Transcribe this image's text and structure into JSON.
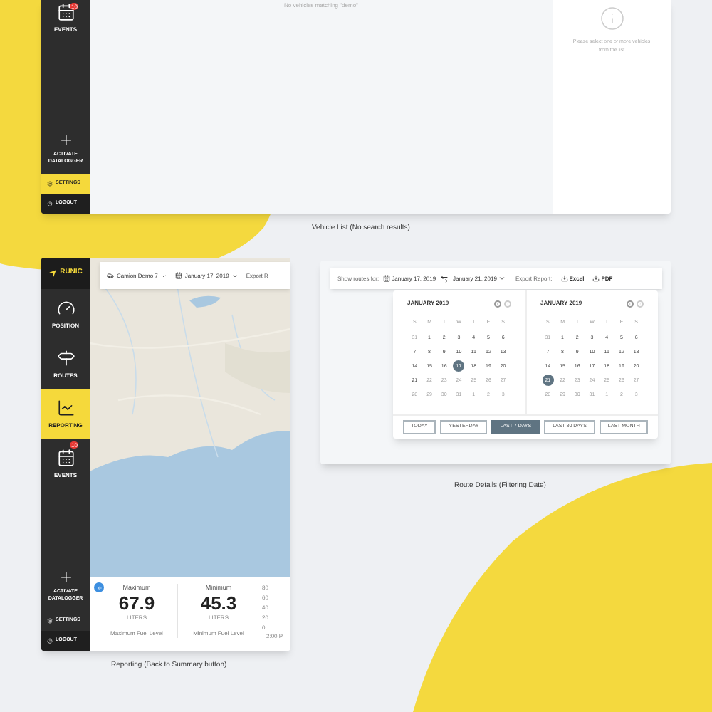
{
  "vehicle_list": {
    "sidebar": {
      "items": [
        {
          "kind": "events",
          "label": "EVENTS",
          "badge": "10",
          "selected": false
        }
      ],
      "activate": "ACTIVATE DATALOGGER",
      "settings": {
        "label": "SETTINGS",
        "selected": true
      },
      "logout": "LOGOUT"
    },
    "empty_message": "No vehicles matching \"demo\"",
    "detail_hint": "Please select one or more vehicles from the list",
    "caption": "Vehicle List (No search results)"
  },
  "reporting": {
    "logo": "RUNIC",
    "sidebar": {
      "items": [
        {
          "kind": "position",
          "label": "POSITION",
          "selected": false
        },
        {
          "kind": "routes",
          "label": "ROUTES",
          "selected": false
        },
        {
          "kind": "reporting",
          "label": "REPORTING",
          "selected": true
        },
        {
          "kind": "events",
          "label": "EVENTS",
          "badge": "10",
          "selected": false
        }
      ],
      "activate": "ACTIVATE DATALOGGER",
      "settings": {
        "label": "SETTINGS",
        "selected": false
      },
      "logout": "LOGOUT"
    },
    "toolbar": {
      "vehicle": "Camion Demo 7",
      "date": "January 17, 2019",
      "export": "Export R"
    },
    "stats": [
      {
        "title": "Maximum",
        "value": "67.9",
        "unit": "LITERS",
        "caption": "Maximum Fuel Level"
      },
      {
        "title": "Minimum",
        "value": "45.3",
        "unit": "LITERS",
        "caption": "Minimum Fuel Level"
      }
    ],
    "chart_ticks": [
      "80",
      "60",
      "40",
      "20",
      "0"
    ],
    "chart_time": "2:00 P",
    "caption": "Reporting (Back to Summary button)"
  },
  "route_details": {
    "toolbar": {
      "label": "Show routes for:",
      "from": "January 17, 2019",
      "to": "January 21, 2019",
      "export_label": "Export Report:",
      "exports": [
        "Excel",
        "PDF"
      ]
    },
    "calendars": [
      {
        "month": "JANUARY 2019",
        "weekdays": [
          "S",
          "M",
          "T",
          "W",
          "T",
          "F",
          "S"
        ],
        "days": [
          {
            "label": "31",
            "muted": true,
            "selected": false
          },
          {
            "label": "1",
            "muted": false,
            "selected": false
          },
          {
            "label": "2",
            "muted": false,
            "selected": false
          },
          {
            "label": "3",
            "muted": false,
            "selected": false
          },
          {
            "label": "4",
            "muted": false,
            "selected": false
          },
          {
            "label": "5",
            "muted": false,
            "selected": false
          },
          {
            "label": "6",
            "muted": false,
            "selected": false
          },
          {
            "label": "7",
            "muted": false,
            "selected": false
          },
          {
            "label": "8",
            "muted": false,
            "selected": false
          },
          {
            "label": "9",
            "muted": false,
            "selected": false
          },
          {
            "label": "10",
            "muted": false,
            "selected": false
          },
          {
            "label": "11",
            "muted": false,
            "selected": false
          },
          {
            "label": "12",
            "muted": false,
            "selected": false
          },
          {
            "label": "13",
            "muted": false,
            "selected": false
          },
          {
            "label": "14",
            "muted": false,
            "selected": false
          },
          {
            "label": "15",
            "muted": false,
            "selected": false
          },
          {
            "label": "16",
            "muted": false,
            "selected": false
          },
          {
            "label": "17",
            "muted": false,
            "selected": true
          },
          {
            "label": "18",
            "muted": false,
            "selected": false
          },
          {
            "label": "19",
            "muted": false,
            "selected": false
          },
          {
            "label": "20",
            "muted": false,
            "selected": false
          },
          {
            "label": "21",
            "muted": false,
            "selected": false
          },
          {
            "label": "22",
            "muted": true,
            "selected": false
          },
          {
            "label": "23",
            "muted": true,
            "selected": false
          },
          {
            "label": "24",
            "muted": true,
            "selected": false
          },
          {
            "label": "25",
            "muted": true,
            "selected": false
          },
          {
            "label": "26",
            "muted": true,
            "selected": false
          },
          {
            "label": "27",
            "muted": true,
            "selected": false
          },
          {
            "label": "28",
            "muted": true,
            "selected": false
          },
          {
            "label": "29",
            "muted": true,
            "selected": false
          },
          {
            "label": "30",
            "muted": true,
            "selected": false
          },
          {
            "label": "31",
            "muted": true,
            "selected": false
          },
          {
            "label": "1",
            "muted": true,
            "selected": false
          },
          {
            "label": "2",
            "muted": true,
            "selected": false
          },
          {
            "label": "3",
            "muted": true,
            "selected": false
          }
        ]
      },
      {
        "month": "JANUARY 2019",
        "weekdays": [
          "S",
          "M",
          "T",
          "W",
          "T",
          "F",
          "S"
        ],
        "days": [
          {
            "label": "31",
            "muted": true,
            "selected": false
          },
          {
            "label": "1",
            "muted": false,
            "selected": false
          },
          {
            "label": "2",
            "muted": false,
            "selected": false
          },
          {
            "label": "3",
            "muted": false,
            "selected": false
          },
          {
            "label": "4",
            "muted": false,
            "selected": false
          },
          {
            "label": "5",
            "muted": false,
            "selected": false
          },
          {
            "label": "6",
            "muted": false,
            "selected": false
          },
          {
            "label": "7",
            "muted": false,
            "selected": false
          },
          {
            "label": "8",
            "muted": false,
            "selected": false
          },
          {
            "label": "9",
            "muted": false,
            "selected": false
          },
          {
            "label": "10",
            "muted": false,
            "selected": false
          },
          {
            "label": "11",
            "muted": false,
            "selected": false
          },
          {
            "label": "12",
            "muted": false,
            "selected": false
          },
          {
            "label": "13",
            "muted": false,
            "selected": false
          },
          {
            "label": "14",
            "muted": false,
            "selected": false
          },
          {
            "label": "15",
            "muted": false,
            "selected": false
          },
          {
            "label": "16",
            "muted": false,
            "selected": false
          },
          {
            "label": "17",
            "muted": false,
            "selected": false
          },
          {
            "label": "18",
            "muted": false,
            "selected": false
          },
          {
            "label": "19",
            "muted": false,
            "selected": false
          },
          {
            "label": "20",
            "muted": false,
            "selected": false
          },
          {
            "label": "21",
            "muted": false,
            "selected": true
          },
          {
            "label": "22",
            "muted": true,
            "selected": false
          },
          {
            "label": "23",
            "muted": true,
            "selected": false
          },
          {
            "label": "24",
            "muted": true,
            "selected": false
          },
          {
            "label": "25",
            "muted": true,
            "selected": false
          },
          {
            "label": "26",
            "muted": true,
            "selected": false
          },
          {
            "label": "27",
            "muted": true,
            "selected": false
          },
          {
            "label": "28",
            "muted": true,
            "selected": false
          },
          {
            "label": "29",
            "muted": true,
            "selected": false
          },
          {
            "label": "30",
            "muted": true,
            "selected": false
          },
          {
            "label": "31",
            "muted": true,
            "selected": false
          },
          {
            "label": "1",
            "muted": true,
            "selected": false
          },
          {
            "label": "2",
            "muted": true,
            "selected": false
          },
          {
            "label": "3",
            "muted": true,
            "selected": false
          }
        ]
      }
    ],
    "quick_ranges": [
      {
        "label": "TODAY",
        "selected": false
      },
      {
        "label": "YESTERDAY",
        "selected": false
      },
      {
        "label": "LAST 7 DAYS",
        "selected": true
      },
      {
        "label": "LAST 30 DAYS",
        "selected": false
      },
      {
        "label": "LAST MONTH",
        "selected": false
      }
    ],
    "caption": "Route Details (Filtering Date)"
  }
}
